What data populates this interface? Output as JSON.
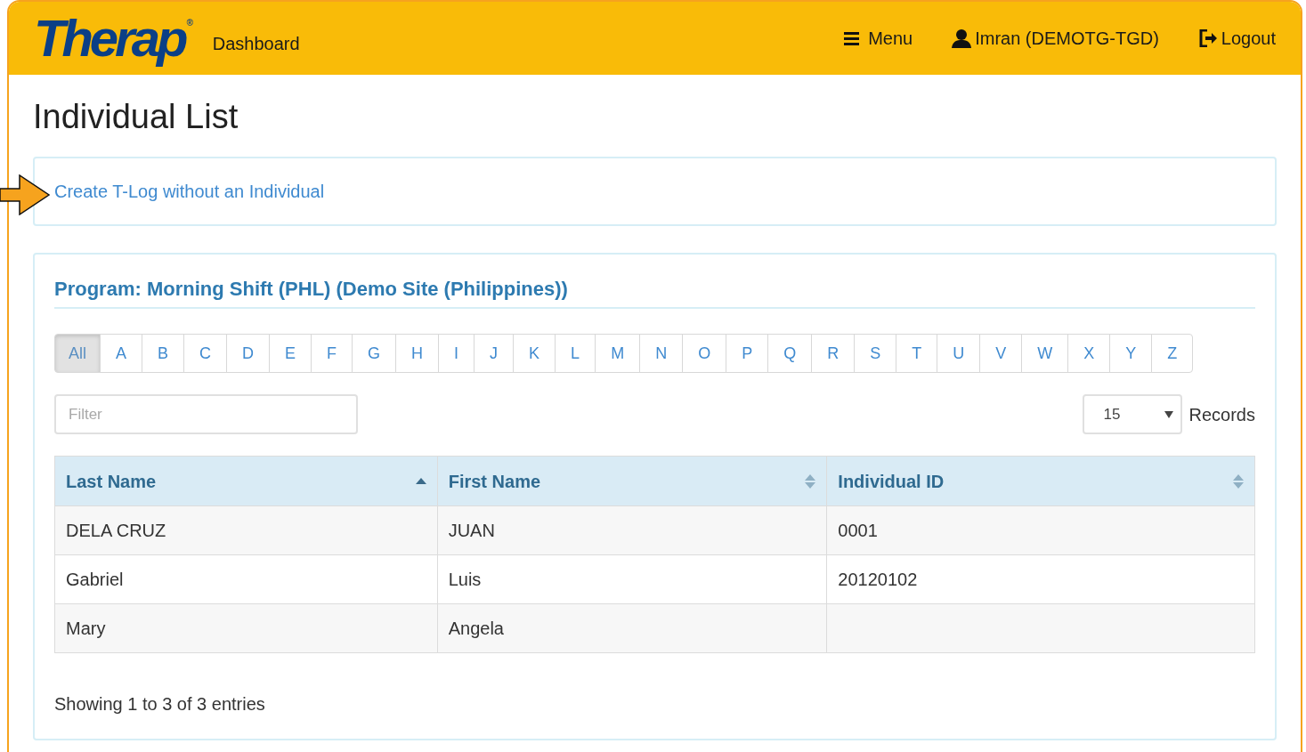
{
  "header": {
    "logo": "Therap",
    "logo_mark": "®",
    "dashboard": "Dashboard",
    "menu": "Menu",
    "user": "Imran (DEMOTG-TGD)",
    "logout": "Logout"
  },
  "page_title": "Individual List",
  "tlog_link": "Create T-Log without an Individual",
  "program_title": "Program: Morning Shift (PHL) (Demo Site (Philippines))",
  "letters": [
    {
      "label": "All",
      "selected": true
    },
    {
      "label": "A",
      "selected": false
    },
    {
      "label": "B",
      "selected": false
    },
    {
      "label": "C",
      "selected": false
    },
    {
      "label": "D",
      "selected": false
    },
    {
      "label": "E",
      "selected": false
    },
    {
      "label": "F",
      "selected": false
    },
    {
      "label": "G",
      "selected": false
    },
    {
      "label": "H",
      "selected": false
    },
    {
      "label": "I",
      "selected": false
    },
    {
      "label": "J",
      "selected": false
    },
    {
      "label": "K",
      "selected": false
    },
    {
      "label": "L",
      "selected": false
    },
    {
      "label": "M",
      "selected": false
    },
    {
      "label": "N",
      "selected": false
    },
    {
      "label": "O",
      "selected": false
    },
    {
      "label": "P",
      "selected": false
    },
    {
      "label": "Q",
      "selected": false
    },
    {
      "label": "R",
      "selected": false
    },
    {
      "label": "S",
      "selected": false
    },
    {
      "label": "T",
      "selected": false
    },
    {
      "label": "U",
      "selected": false
    },
    {
      "label": "V",
      "selected": false
    },
    {
      "label": "W",
      "selected": false
    },
    {
      "label": "X",
      "selected": false
    },
    {
      "label": "Y",
      "selected": false
    },
    {
      "label": "Z",
      "selected": false
    }
  ],
  "filter": {
    "placeholder": "Filter"
  },
  "records": {
    "value": "15",
    "label": "Records"
  },
  "table": {
    "columns": [
      {
        "label": "Last Name",
        "sorted": true
      },
      {
        "label": "First Name",
        "sorted": false
      },
      {
        "label": "Individual ID",
        "sorted": false
      }
    ],
    "rows": [
      [
        "DELA CRUZ",
        "JUAN",
        "0001"
      ],
      [
        "Gabriel",
        "Luis",
        "20120102"
      ],
      [
        "Mary",
        "Angela",
        ""
      ]
    ]
  },
  "footer": "Showing 1 to 3 of 3 entries"
}
